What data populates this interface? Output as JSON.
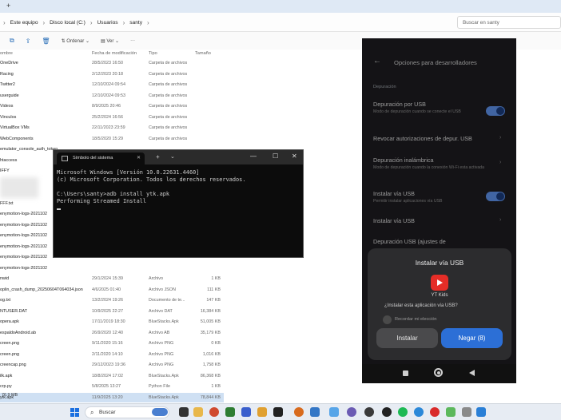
{
  "explorer": {
    "tab_add": "+",
    "breadcrumb": [
      "Este equipo",
      "Disco local (C:)",
      "Usuarios",
      "santy"
    ],
    "search_placeholder": "Buscar en santy",
    "toolbar": {
      "sort_label": "Ordenar",
      "view_label": "Ver",
      "more_label": "···"
    },
    "columns": {
      "name": "ombre",
      "date": "Fecha de modificación",
      "type": "Tipo",
      "size": "Tamaño"
    },
    "files": [
      {
        "name": "OneDrive",
        "date": "28/5/2023 16:50",
        "type": "Carpeta de archivos",
        "size": ""
      },
      {
        "name": "Racing",
        "date": "2/12/2023 20:18",
        "type": "Carpeta de archivos",
        "size": ""
      },
      {
        "name": "Twitter2",
        "date": "12/10/2024 09:54",
        "type": "Carpeta de archivos",
        "size": ""
      },
      {
        "name": "userguide",
        "date": "12/10/2024 09:53",
        "type": "Carpeta de archivos",
        "size": ""
      },
      {
        "name": "Videos",
        "date": "8/9/2025 20:46",
        "type": "Carpeta de archivos",
        "size": ""
      },
      {
        "name": "Vinculos",
        "date": "25/2/2024 16:56",
        "type": "Carpeta de archivos",
        "size": ""
      },
      {
        "name": "VirtualBox VMs",
        "date": "22/11/2023 23:59",
        "type": "Carpeta de archivos",
        "size": ""
      },
      {
        "name": "WebComponents",
        "date": "18/5/2020 15:29",
        "type": "Carpeta de archivos",
        "size": ""
      },
      {
        "name": "emulator_console_auth_token",
        "date": "",
        "type": "",
        "size": ""
      },
      {
        "name": "htaccess",
        "date": "",
        "type": "",
        "size": ""
      },
      {
        "name": "IFFY",
        "date": "",
        "type": "",
        "size": ""
      },
      {
        "name": "",
        "date": "",
        "type": "",
        "size": ""
      },
      {
        "name": "",
        "date": "",
        "type": "",
        "size": ""
      },
      {
        "name": "FFF.txt",
        "date": "",
        "type": "",
        "size": ""
      },
      {
        "name": "enymotion-logs-2021102",
        "date": "",
        "type": "",
        "size": ""
      },
      {
        "name": "enymotion-logs-2021102",
        "date": "",
        "type": "",
        "size": ""
      },
      {
        "name": "enymotion-logs-2021102",
        "date": "",
        "type": "",
        "size": ""
      },
      {
        "name": "enymotion-logs-2021102",
        "date": "",
        "type": "",
        "size": ""
      },
      {
        "name": "enymotion-logs-2021102",
        "date": "",
        "type": "",
        "size": ""
      },
      {
        "name": "enymotion-logs-2021102",
        "date": "",
        "type": "",
        "size": ""
      },
      {
        "name": "nwid",
        "date": "29/1/2024 15:39",
        "type": "Archivo",
        "size": "1 KB"
      },
      {
        "name": "oplin_crash_dump_20250604T064034.json",
        "date": "4/6/2025 01:40",
        "type": "Archivo JSON",
        "size": "111 KB"
      },
      {
        "name": "og.txt",
        "date": "13/2/2024 19:26",
        "type": "Documento de te...",
        "size": "147 KB"
      },
      {
        "name": "NTUSER.DAT",
        "date": "10/9/2025 22:27",
        "type": "Archivo DAT",
        "size": "16,384 KB"
      },
      {
        "name": "opera.apk",
        "date": "17/11/2019 18:30",
        "type": "BlueStacks.Apk",
        "size": "51,005 KB"
      },
      {
        "name": "espaldoAndroid.ab",
        "date": "26/9/2020 12:40",
        "type": "Archivo AB",
        "size": "35,179 KB"
      },
      {
        "name": "creen.png",
        "date": "9/11/2020 15:16",
        "type": "Archivo PNG",
        "size": "0 KB"
      },
      {
        "name": "creen.png",
        "date": "2/11/2020 14:10",
        "type": "Archivo PNG",
        "size": "1,016 KB"
      },
      {
        "name": "creencap.png",
        "date": "29/12/2023 19:36",
        "type": "Archivo PNG",
        "size": "1,758 KB"
      },
      {
        "name": "ilk.apk",
        "date": "18/8/2024 17:02",
        "type": "BlueStacks.Apk",
        "size": "86,368 KB"
      },
      {
        "name": "crp.py",
        "date": "5/8/2025 13:27",
        "type": "Python File",
        "size": "1 KB"
      },
      {
        "name": "ytk.apk",
        "date": "11/9/2025 13:20",
        "type": "BlueStacks.Apk",
        "size": "78,844 KB"
      }
    ],
    "status": "76.9 MB"
  },
  "cmd": {
    "tab_title": "Símbolo del sistema",
    "tab_close": "✕",
    "new_tab": "+",
    "dropdown": "⌄",
    "minimize": "—",
    "maximize": "☐",
    "close": "✕",
    "lines": [
      "Microsoft Windows [Versión 10.0.22631.4460]",
      "(c) Microsoft Corporation. Todos los derechos reservados.",
      "",
      "C:\\Users\\santy>adb install ytk.apk",
      "Performing Streamed Install"
    ]
  },
  "phone": {
    "title": "Opciones para desarrolladores",
    "section": "Depuración",
    "items": [
      {
        "title": "Depuración por USB",
        "subtitle": "Modo de depuración cuando se conecte el USB",
        "toggle": true
      },
      {
        "title": "Revocar autorizaciones de depur. USB",
        "subtitle": "",
        "toggle": false
      },
      {
        "title": "Depuración inalámbrica",
        "subtitle": "Modo de depuración cuando la conexión Wi-Fi esta activada",
        "toggle": false
      },
      {
        "title": "Instalar vía USB",
        "subtitle": "Permitir instalar aplicaciones vía USB",
        "toggle": true
      },
      {
        "title": "Instalar vía USB",
        "subtitle": "",
        "toggle": false
      },
      {
        "title": "Depuración USB (ajustes de",
        "subtitle": "",
        "toggle": false
      }
    ],
    "dialog": {
      "title": "Instalar vía USB",
      "app_name": "YT Kids",
      "question": "¿Instalar esta aplicación vía USB?",
      "remember": "Recordar mi elección",
      "install_label": "Instalar",
      "deny_label": "Negar (8)"
    },
    "colors": {
      "accent": "#2c6fd6",
      "toggle_on": "#5b8de2"
    }
  },
  "taskbar": {
    "search_label": "Buscar"
  }
}
